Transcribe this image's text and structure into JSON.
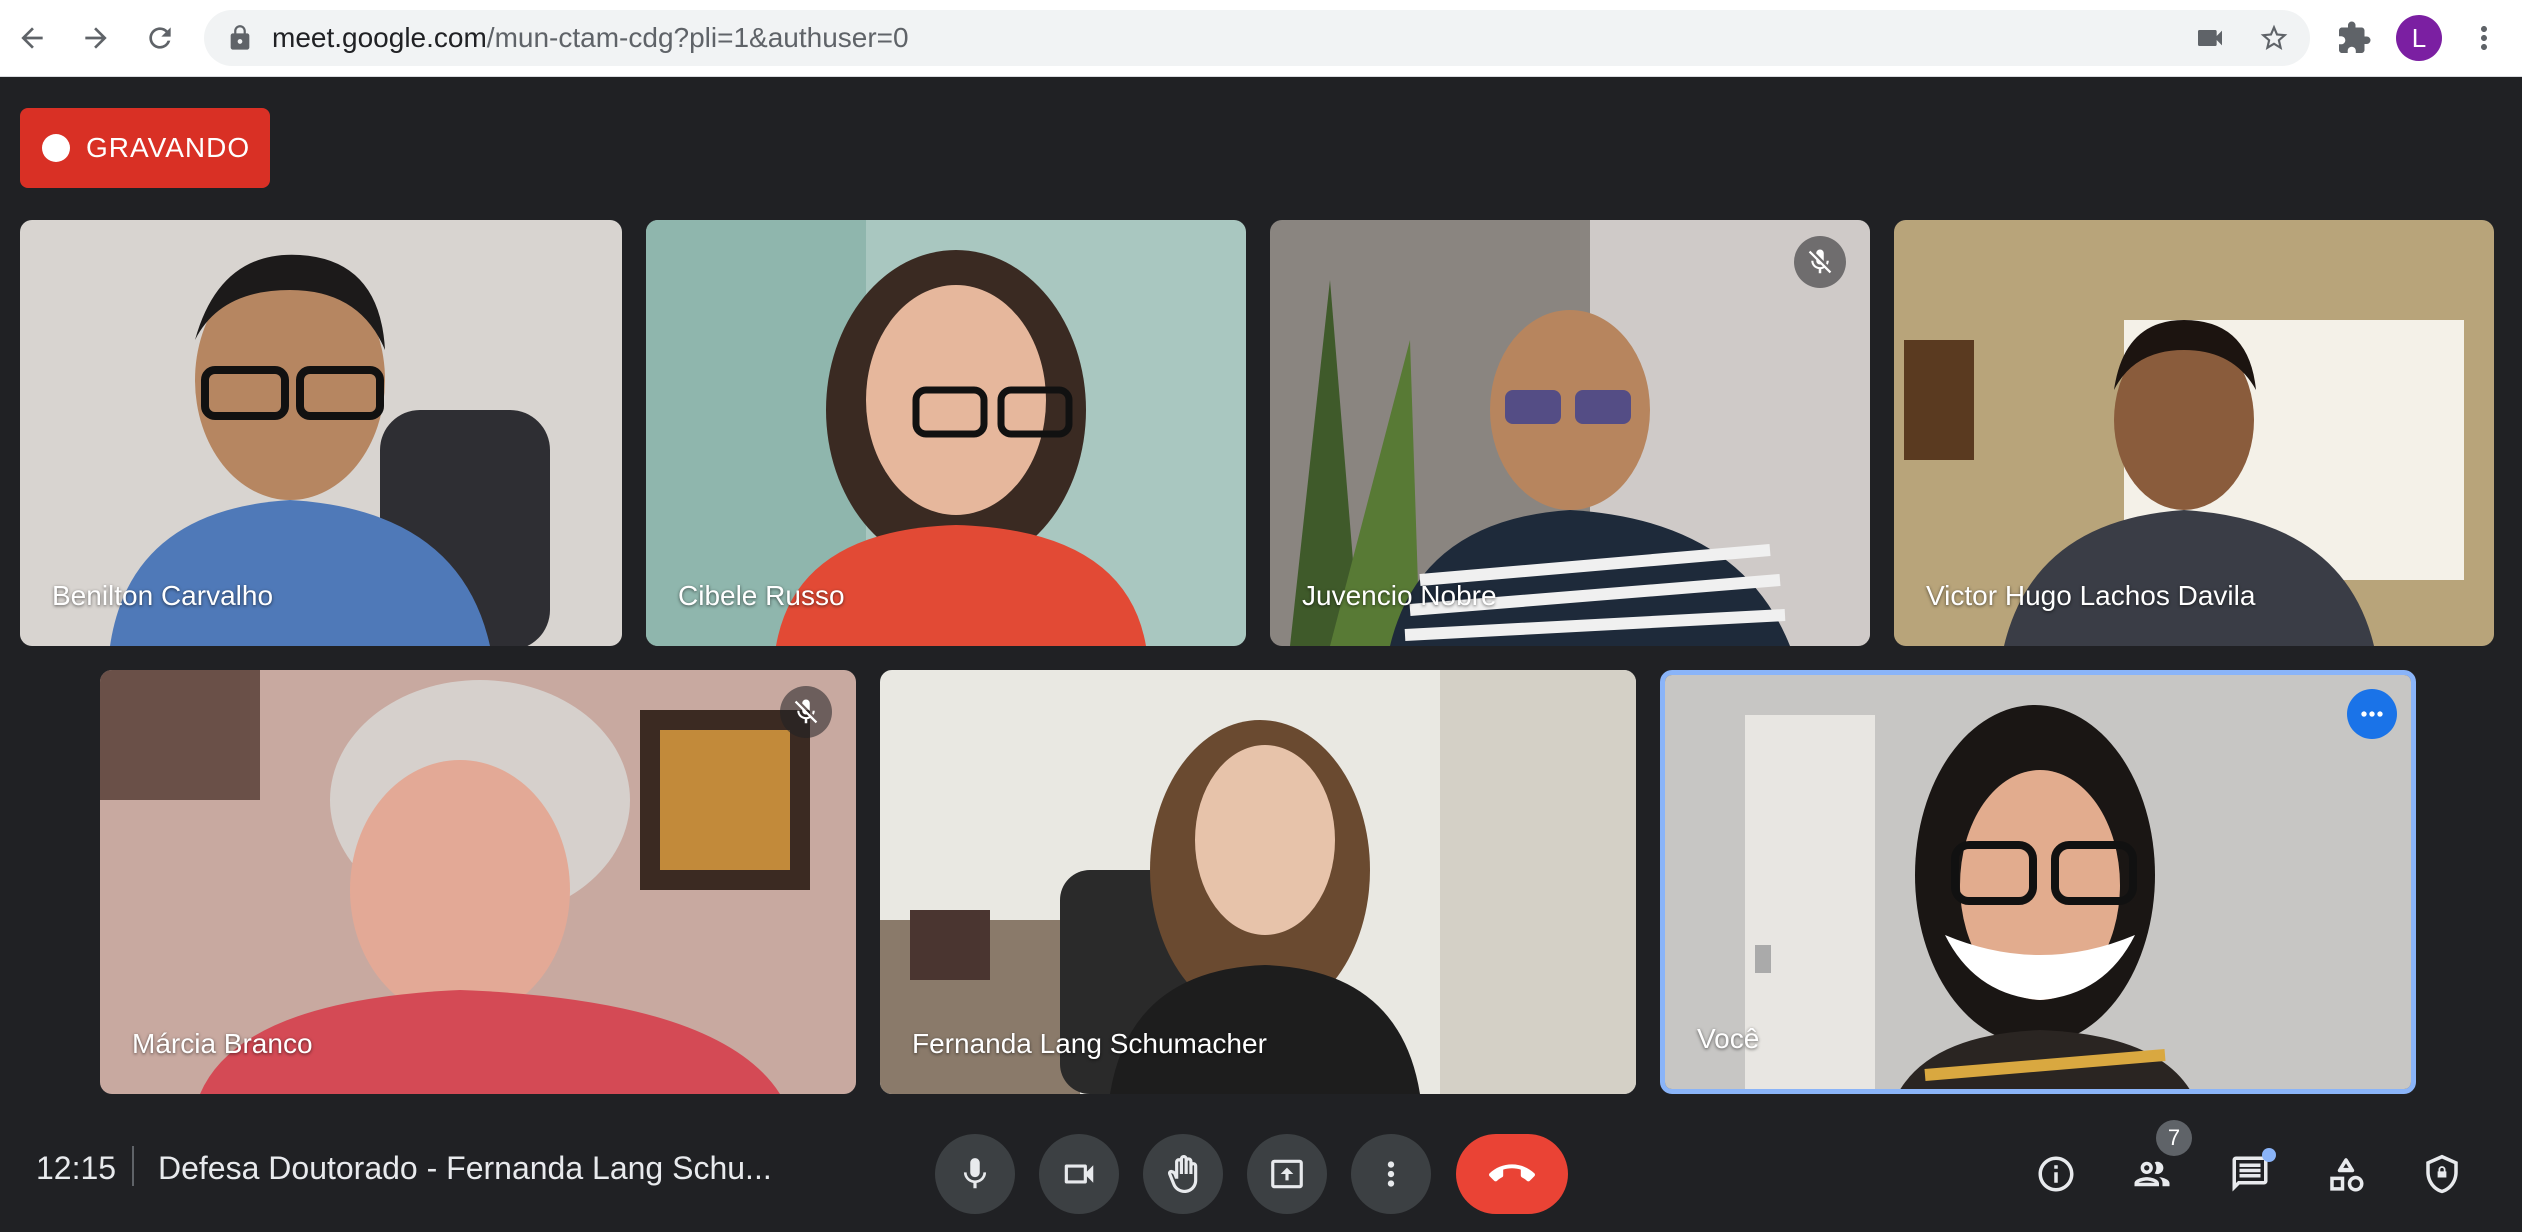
{
  "browser": {
    "url_host": "meet.google.com",
    "url_path": "/mun-ctam-cdg?pli=1&authuser=0",
    "profile_initial": "L"
  },
  "recording": {
    "label": "GRAVANDO"
  },
  "participants": [
    {
      "name": "Benilton Carvalho",
      "muted": false
    },
    {
      "name": "Cibele Russo",
      "muted": false
    },
    {
      "name": "Juvencio Nobre",
      "muted": true
    },
    {
      "name": "Victor Hugo Lachos Davila",
      "muted": false
    },
    {
      "name": "Márcia Branco",
      "muted": true
    },
    {
      "name": "Fernanda Lang Schumacher",
      "muted": false
    },
    {
      "name": "Você",
      "muted": false,
      "self": true
    }
  ],
  "bottom_bar": {
    "time": "12:15",
    "meeting_title": "Defesa Doutorado - Fernanda Lang Schu...",
    "participant_count": "7"
  },
  "colors": {
    "background": "#202124",
    "recording_red": "#d93025",
    "end_call_red": "#ea4335",
    "self_border": "#8ab4f8",
    "accent_blue": "#1a73e8"
  },
  "icons": {
    "back": "arrow-back-icon",
    "forward": "arrow-forward-icon",
    "reload": "reload-icon",
    "lock": "lock-icon",
    "camera": "camera-icon",
    "star": "star-icon",
    "extensions": "puzzle-icon",
    "menu": "kebab-menu-icon",
    "mic": "microphone-icon",
    "video": "video-camera-icon",
    "hand": "raise-hand-icon",
    "present": "present-screen-icon",
    "more": "more-vert-icon",
    "end_call": "end-call-icon",
    "info": "info-icon",
    "people": "people-icon",
    "chat": "chat-icon",
    "activities": "activities-icon",
    "host_controls": "shield-lock-icon"
  }
}
